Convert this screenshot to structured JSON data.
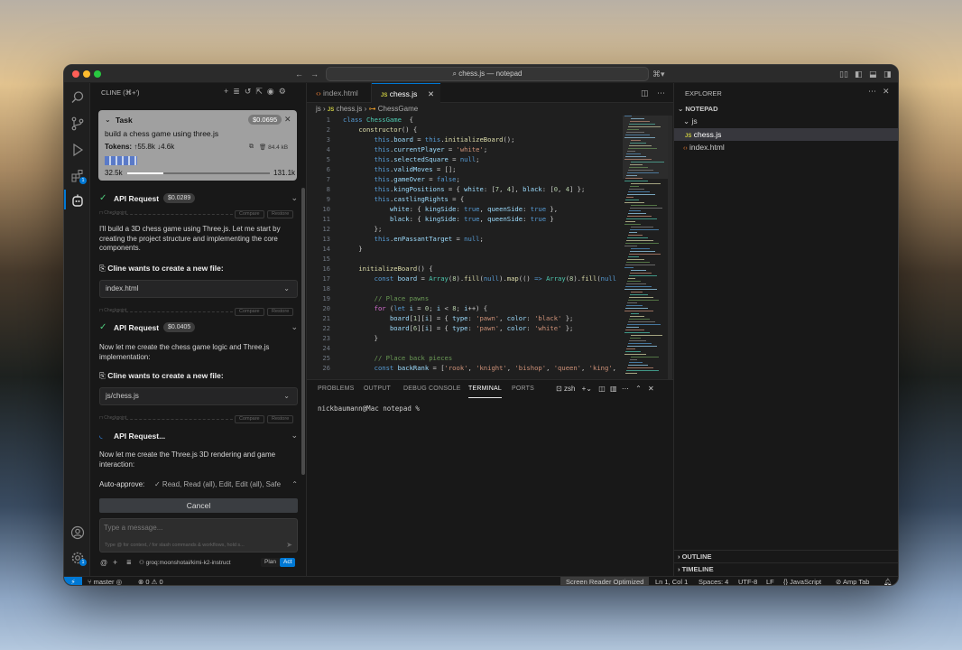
{
  "titlebar": {
    "search_text": "chess.js — notepad"
  },
  "cline": {
    "title": "CLINE (⌘+')",
    "task": {
      "label": "Task",
      "cost": "$0.0695",
      "description": "build a chess game using three.js",
      "tokens_label": "Tokens:",
      "tokens_up": "55.8k",
      "tokens_down": "4.6k",
      "size": "84.4 kB",
      "context_used": "32.5k",
      "context_max": "131.1k",
      "context_fraction": 0.25
    },
    "requests": [
      {
        "label": "API Request",
        "cost": "$0.0289"
      },
      {
        "label": "API Request",
        "cost": "$0.0405"
      },
      {
        "label": "API Request..."
      }
    ],
    "checkpoint": {
      "label": "Checkpoint",
      "compare": "Compare",
      "restore": "Restore"
    },
    "messages": [
      "I'll build a 3D chess game using Three.js. Let me start by creating the project structure and implementing the core components.",
      "Now let me create the chess game logic and Three.js implementation:",
      "Now let me create the Three.js 3D rendering and game interaction:"
    ],
    "create_file_label": "Cline wants to create a new file:",
    "files": [
      "index.html",
      "js/chess.js"
    ],
    "auto_approve_label": "Auto-approve:",
    "auto_approve_value": "✓ Read, Read (all), Edit, Edit (all), Safe",
    "cancel_label": "Cancel",
    "input_placeholder": "Type a message...",
    "input_hint": "Type @ for context, / for slash commands & workflows, hold s...",
    "model": "groq:moonshotai/kimi-k2-instruct",
    "plan_label": "Plan",
    "act_label": "Act"
  },
  "editor": {
    "tabs": [
      {
        "label": "index.html"
      },
      {
        "label": "chess.js"
      }
    ],
    "breadcrumb": {
      "folder": "js",
      "file": "chess.js",
      "symbol": "ChessGame"
    },
    "code_lines": [
      [
        [
          "k",
          "class "
        ],
        [
          "c",
          "ChessGame"
        ],
        [
          "",
          "  {"
        ]
      ],
      [
        [
          "",
          "    "
        ],
        [
          "f",
          "constructor"
        ],
        [
          "",
          "() {"
        ]
      ],
      [
        [
          "",
          "        "
        ],
        [
          "t",
          "this"
        ],
        [
          "",
          "."
        ],
        [
          "v",
          "board"
        ],
        [
          "",
          " = "
        ],
        [
          "t",
          "this"
        ],
        [
          "",
          "."
        ],
        [
          "f",
          "initializeBoard"
        ],
        [
          "",
          "();"
        ]
      ],
      [
        [
          "",
          "        "
        ],
        [
          "t",
          "this"
        ],
        [
          "",
          "."
        ],
        [
          "v",
          "currentPlayer"
        ],
        [
          "",
          " = "
        ],
        [
          "s",
          "'white'"
        ],
        [
          "",
          ";"
        ]
      ],
      [
        [
          "",
          "        "
        ],
        [
          "t",
          "this"
        ],
        [
          "",
          "."
        ],
        [
          "v",
          "selectedSquare"
        ],
        [
          "",
          " = "
        ],
        [
          "t",
          "null"
        ],
        [
          "",
          ";"
        ]
      ],
      [
        [
          "",
          "        "
        ],
        [
          "t",
          "this"
        ],
        [
          "",
          "."
        ],
        [
          "v",
          "validMoves"
        ],
        [
          "",
          " = [];"
        ]
      ],
      [
        [
          "",
          "        "
        ],
        [
          "t",
          "this"
        ],
        [
          "",
          "."
        ],
        [
          "v",
          "gameOver"
        ],
        [
          "",
          " = "
        ],
        [
          "t",
          "false"
        ],
        [
          "",
          ";"
        ]
      ],
      [
        [
          "",
          "        "
        ],
        [
          "t",
          "this"
        ],
        [
          "",
          "."
        ],
        [
          "v",
          "kingPositions"
        ],
        [
          "",
          " = { "
        ],
        [
          "v",
          "white"
        ],
        [
          "",
          ": ["
        ],
        [
          "n",
          "7"
        ],
        [
          "",
          ", "
        ],
        [
          "n",
          "4"
        ],
        [
          "",
          "], "
        ],
        [
          "v",
          "black"
        ],
        [
          "",
          ": ["
        ],
        [
          "n",
          "0"
        ],
        [
          "",
          ", "
        ],
        [
          "n",
          "4"
        ],
        [
          "",
          "] };"
        ]
      ],
      [
        [
          "",
          "        "
        ],
        [
          "t",
          "this"
        ],
        [
          "",
          "."
        ],
        [
          "v",
          "castlingRights"
        ],
        [
          "",
          " = {"
        ]
      ],
      [
        [
          "",
          "            "
        ],
        [
          "v",
          "white"
        ],
        [
          "",
          ": { "
        ],
        [
          "v",
          "kingSide"
        ],
        [
          "",
          ": "
        ],
        [
          "t",
          "true"
        ],
        [
          "",
          ", "
        ],
        [
          "v",
          "queenSide"
        ],
        [
          "",
          ": "
        ],
        [
          "t",
          "true"
        ],
        [
          "",
          " },"
        ]
      ],
      [
        [
          "",
          "            "
        ],
        [
          "v",
          "black"
        ],
        [
          "",
          ": { "
        ],
        [
          "v",
          "kingSide"
        ],
        [
          "",
          ": "
        ],
        [
          "t",
          "true"
        ],
        [
          "",
          ", "
        ],
        [
          "v",
          "queenSide"
        ],
        [
          "",
          ": "
        ],
        [
          "t",
          "true"
        ],
        [
          "",
          " }"
        ]
      ],
      [
        [
          "",
          "        };"
        ]
      ],
      [
        [
          "",
          "        "
        ],
        [
          "t",
          "this"
        ],
        [
          "",
          "."
        ],
        [
          "v",
          "enPassantTarget"
        ],
        [
          "",
          " = "
        ],
        [
          "t",
          "null"
        ],
        [
          "",
          ";"
        ]
      ],
      [
        [
          "",
          "    }"
        ]
      ],
      [
        [
          "",
          ""
        ]
      ],
      [
        [
          "",
          "    "
        ],
        [
          "f",
          "initializeBoard"
        ],
        [
          "",
          "() {"
        ]
      ],
      [
        [
          "",
          "        "
        ],
        [
          "k",
          "const "
        ],
        [
          "v",
          "board"
        ],
        [
          "",
          " = "
        ],
        [
          "c",
          "Array"
        ],
        [
          "",
          "("
        ],
        [
          "n",
          "8"
        ],
        [
          "",
          ")."
        ],
        [
          "f",
          "fill"
        ],
        [
          "",
          "("
        ],
        [
          "t",
          "null"
        ],
        [
          "",
          ")."
        ],
        [
          "f",
          "map"
        ],
        [
          "",
          "(() "
        ],
        [
          "k",
          "=>"
        ],
        [
          "",
          " "
        ],
        [
          "c",
          "Array"
        ],
        [
          "",
          "("
        ],
        [
          "n",
          "8"
        ],
        [
          "",
          ")."
        ],
        [
          "f",
          "fill"
        ],
        [
          "",
          "("
        ],
        [
          "t",
          "null"
        ]
      ],
      [
        [
          "",
          ""
        ]
      ],
      [
        [
          "",
          "        "
        ],
        [
          "cm",
          "// Place pawns"
        ]
      ],
      [
        [
          "",
          "        "
        ],
        [
          "p",
          "for"
        ],
        [
          "",
          " ("
        ],
        [
          "k",
          "let "
        ],
        [
          "v",
          "i"
        ],
        [
          "",
          " = "
        ],
        [
          "n",
          "0"
        ],
        [
          "",
          "; "
        ],
        [
          "v",
          "i"
        ],
        [
          "",
          " < "
        ],
        [
          "n",
          "8"
        ],
        [
          "",
          "; "
        ],
        [
          "v",
          "i"
        ],
        [
          "",
          "++) {"
        ]
      ],
      [
        [
          "",
          "            "
        ],
        [
          "v",
          "board"
        ],
        [
          "",
          "["
        ],
        [
          "n",
          "1"
        ],
        [
          "",
          "]["
        ],
        [
          "v",
          "i"
        ],
        [
          "",
          "] = { "
        ],
        [
          "v",
          "type"
        ],
        [
          "",
          ": "
        ],
        [
          "s",
          "'pawn'"
        ],
        [
          "",
          ", "
        ],
        [
          "v",
          "color"
        ],
        [
          "",
          ": "
        ],
        [
          "s",
          "'black'"
        ],
        [
          "",
          " };"
        ]
      ],
      [
        [
          "",
          "            "
        ],
        [
          "v",
          "board"
        ],
        [
          "",
          "["
        ],
        [
          "n",
          "6"
        ],
        [
          "",
          "]["
        ],
        [
          "v",
          "i"
        ],
        [
          "",
          "] = { "
        ],
        [
          "v",
          "type"
        ],
        [
          "",
          ": "
        ],
        [
          "s",
          "'pawn'"
        ],
        [
          "",
          ", "
        ],
        [
          "v",
          "color"
        ],
        [
          "",
          ": "
        ],
        [
          "s",
          "'white'"
        ],
        [
          "",
          " };"
        ]
      ],
      [
        [
          "",
          "        }"
        ]
      ],
      [
        [
          "",
          ""
        ]
      ],
      [
        [
          "",
          "        "
        ],
        [
          "cm",
          "// Place back pieces"
        ]
      ],
      [
        [
          "",
          "        "
        ],
        [
          "k",
          "const "
        ],
        [
          "v",
          "backRank"
        ],
        [
          "",
          " = ["
        ],
        [
          "s",
          "'rook'"
        ],
        [
          "",
          ", "
        ],
        [
          "s",
          "'knight'"
        ],
        [
          "",
          ", "
        ],
        [
          "s",
          "'bishop'"
        ],
        [
          "",
          ", "
        ],
        [
          "s",
          "'queen'"
        ],
        [
          "",
          ", "
        ],
        [
          "s",
          "'king'"
        ],
        [
          "",
          ","
        ]
      ]
    ]
  },
  "panel": {
    "tabs": [
      "PROBLEMS",
      "OUTPUT",
      "DEBUG CONSOLE",
      "TERMINAL",
      "PORTS"
    ],
    "active_tab": "TERMINAL",
    "shell": "zsh",
    "prompt": "nickbaumann@Mac notepad %"
  },
  "explorer": {
    "title": "EXPLORER",
    "root": "NOTEPAD",
    "folder": "js",
    "files": [
      {
        "name": "chess.js",
        "type": "js"
      },
      {
        "name": "index.html",
        "type": "html"
      }
    ],
    "outline": "OUTLINE",
    "timeline": "TIMELINE"
  },
  "status": {
    "branch": "master",
    "errors": "0",
    "warnings": "0",
    "screen_reader": "Screen Reader Optimized",
    "position": "Ln 1, Col 1",
    "spaces": "Spaces: 4",
    "encoding": "UTF-8",
    "eol": "LF",
    "language": "JavaScript",
    "extension": "Amp Tab"
  },
  "colors": {
    "accent": "#0078d4",
    "success": "#4ec97b",
    "cline_badge": "#3c3c3c",
    "js_icon": "#cbcb41",
    "html_icon": "#e37933"
  },
  "icons": [
    "explorer-icon",
    "search-icon",
    "source-control-icon",
    "run-debug-icon",
    "extensions-icon",
    "cline-icon",
    "account-icon",
    "settings-icon"
  ]
}
